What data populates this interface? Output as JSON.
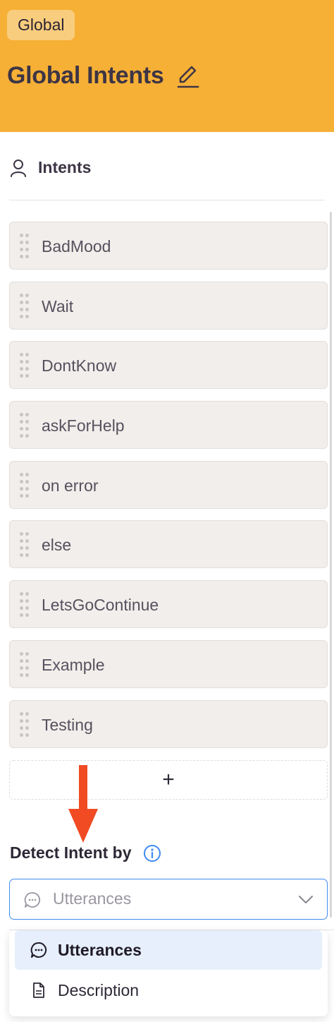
{
  "header": {
    "badge": "Global",
    "title": "Global Intents",
    "background_color": "#f6b036"
  },
  "intents_section": {
    "label": "Intents",
    "items": [
      {
        "label": "BadMood"
      },
      {
        "label": "Wait"
      },
      {
        "label": "DontKnow"
      },
      {
        "label": "askForHelp"
      },
      {
        "label": "on error"
      },
      {
        "label": "else"
      },
      {
        "label": "LetsGoContinue"
      },
      {
        "label": "Example"
      },
      {
        "label": "Testing"
      }
    ],
    "add_label": "+"
  },
  "detect": {
    "label": "Detect Intent by",
    "selected_value": "Utterances",
    "accent_color": "#3d8bf2",
    "options": [
      {
        "label": "Utterances",
        "icon": "chat-bubble-icon"
      },
      {
        "label": "Description",
        "icon": "document-icon"
      }
    ]
  },
  "annotation": {
    "arrow_color": "#f04b23"
  }
}
